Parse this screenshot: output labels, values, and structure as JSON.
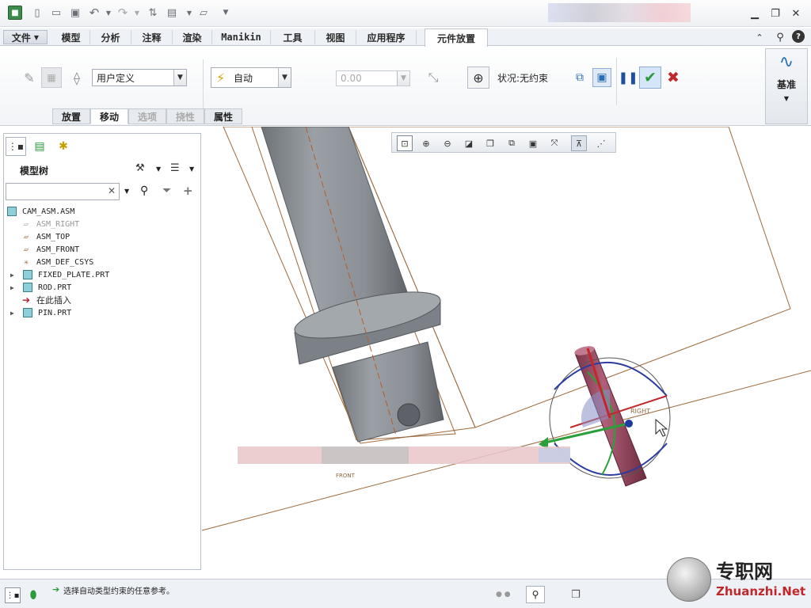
{
  "menu": {
    "file": "文件",
    "tabs": [
      "模型",
      "分析",
      "注释",
      "渲染",
      "Manikin",
      "工具",
      "视图",
      "应用程序"
    ],
    "active_tab": "元件放置"
  },
  "ribbon": {
    "constraint_set": "用户定义",
    "constraint_type": "自动",
    "offset_value": "0.00",
    "status": "状况:无约束",
    "subtabs": {
      "placement": "放置",
      "move": "移动",
      "options": "选项",
      "flexibility": "挠性",
      "properties": "属性"
    },
    "datum_label": "基准"
  },
  "model_tree": {
    "title": "模型树",
    "search_placeholder": "",
    "items": [
      {
        "label": "CAM_ASM.ASM",
        "icon": "assembly-icon"
      },
      {
        "label": "ASM_RIGHT",
        "icon": "datum-plane-icon",
        "dim": true
      },
      {
        "label": "ASM_TOP",
        "icon": "datum-plane-icon"
      },
      {
        "label": "ASM_FRONT",
        "icon": "datum-plane-icon"
      },
      {
        "label": "ASM_DEF_CSYS",
        "icon": "csys-icon"
      },
      {
        "label": "FIXED_PLATE.PRT",
        "icon": "part-icon",
        "expandable": true
      },
      {
        "label": "ROD.PRT",
        "icon": "part-icon",
        "expandable": true
      },
      {
        "label": "在此插入",
        "icon": "insert-arrow-icon"
      },
      {
        "label": "PIN.PRT",
        "icon": "part-icon",
        "expandable": true
      }
    ]
  },
  "viewport": {
    "labels": {
      "right": "RIGHT",
      "front": "FRONT"
    }
  },
  "status": {
    "message": "选择自动类型约束的任意参考。"
  },
  "watermark": {
    "cn": "专职网",
    "en": "Zhuanzhi.Net"
  },
  "colors": {
    "accent": "#2a6fb5",
    "confirm": "#2a9a3a",
    "cancel": "#c0282c",
    "datum": "#9c6a3c"
  }
}
